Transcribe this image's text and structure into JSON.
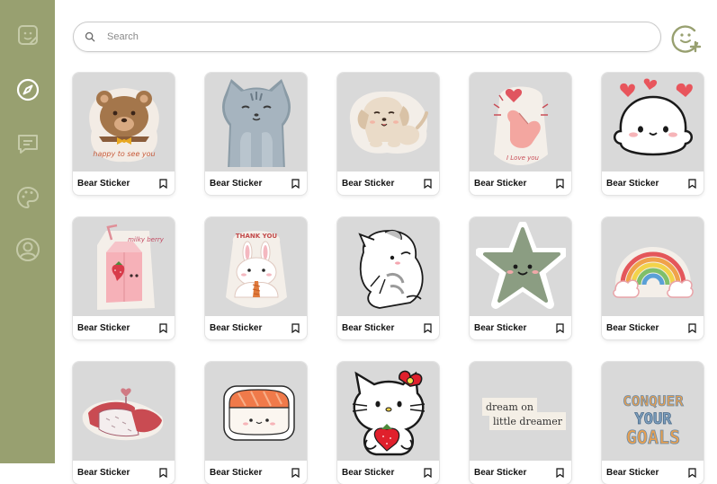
{
  "sidebar": {
    "items": [
      {
        "icon": "sticker-icon",
        "active": false
      },
      {
        "icon": "compass-icon",
        "active": true
      },
      {
        "icon": "message-icon",
        "active": false
      },
      {
        "icon": "palette-icon",
        "active": false
      },
      {
        "icon": "profile-icon",
        "active": false
      }
    ]
  },
  "search": {
    "placeholder": "Search",
    "value": ""
  },
  "header": {
    "add_icon": "add-sticker-icon"
  },
  "stickers": [
    {
      "title": "Bear Sticker",
      "art": "bear",
      "caption": "happy to see you"
    },
    {
      "title": "Bear Sticker",
      "art": "cat"
    },
    {
      "title": "Bear Sticker",
      "art": "puppy"
    },
    {
      "title": "Bear Sticker",
      "art": "heart-hand",
      "caption": "I Love you"
    },
    {
      "title": "Bear Sticker",
      "art": "seal"
    },
    {
      "title": "Bear Sticker",
      "art": "milk",
      "caption": "milky berry"
    },
    {
      "title": "Bear Sticker",
      "art": "bunny",
      "caption": "THANK YOU"
    },
    {
      "title": "Bear Sticker",
      "art": "kitten"
    },
    {
      "title": "Bear Sticker",
      "art": "star"
    },
    {
      "title": "Bear Sticker",
      "art": "rainbow"
    },
    {
      "title": "Bear Sticker",
      "art": "sushi"
    },
    {
      "title": "Bear Sticker",
      "art": "salmon"
    },
    {
      "title": "Bear Sticker",
      "art": "hello-kitty"
    },
    {
      "title": "Bear Sticker",
      "art": "quote",
      "caption_lines": [
        "dream on",
        "little dreamer"
      ]
    },
    {
      "title": "Bear Sticker",
      "art": "goals",
      "caption_lines": [
        "CONQUER",
        "YOUR",
        "GOALS"
      ]
    }
  ],
  "colors": {
    "sidebar": "#98a070",
    "accent": "#98a070",
    "thumb": "#d9d9d9"
  }
}
